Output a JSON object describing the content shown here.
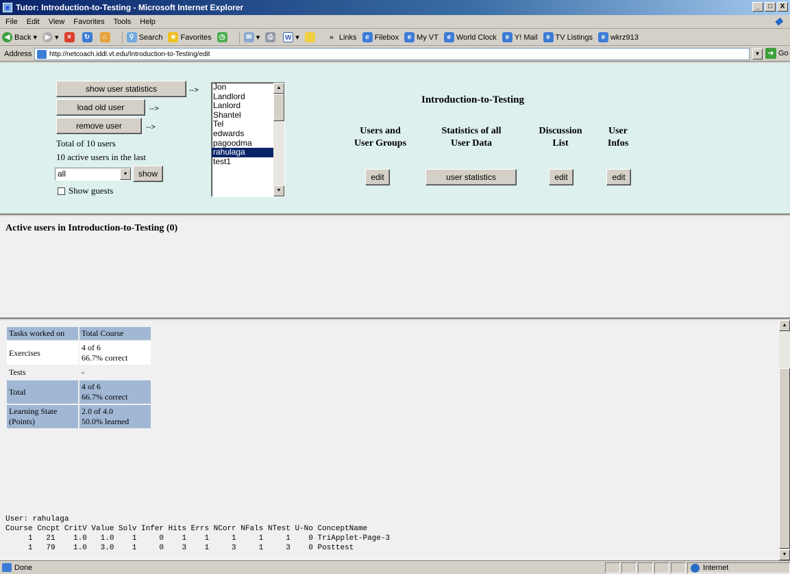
{
  "window": {
    "title": "Tutor: Introduction-to-Testing - Microsoft Internet Explorer",
    "controls": [
      "_",
      "□",
      "X"
    ]
  },
  "menu": [
    "File",
    "Edit",
    "View",
    "Favorites",
    "Tools",
    "Help"
  ],
  "toolbar": {
    "back": "Back",
    "search": "Search",
    "favorites": "Favorites",
    "links_label": "Links",
    "links": [
      "Filebox",
      "My VT",
      "World Clock",
      "Y! Mail",
      "TV Listings",
      "wkrz913"
    ]
  },
  "address": {
    "label": "Address",
    "url": "http://netcoach.iddl.vt.edu/Introduction-to-Testing/edit",
    "go": "Go"
  },
  "top_frame": {
    "show_stats_btn": "show user statistics",
    "load_old_btn": "load old user",
    "remove_btn": "remove user",
    "arrow": "-->",
    "total_users": "Total of 10 users",
    "active_users": "10 active users in the last",
    "period_value": "all",
    "show_btn": "show",
    "show_guests": "Show guests",
    "user_list": [
      "Jon",
      "Landlord",
      "Lanlord",
      "Shantel",
      "Tel",
      "edwards",
      "pagoodma",
      "rahulaga",
      "test1"
    ],
    "selected_user": "rahulaga",
    "course_title": "Introduction-to-Testing",
    "sections": [
      {
        "title": "Users and\nUser Groups",
        "button": "edit"
      },
      {
        "title": "Statistics of all\nUser Data",
        "button": "user statistics"
      },
      {
        "title": "Discussion\nList",
        "button": "edit"
      },
      {
        "title": "User\nInfos",
        "button": "edit"
      }
    ]
  },
  "mid_frame": {
    "active_heading": "Active users in Introduction-to-Testing (0)"
  },
  "stats_table": {
    "headers": [
      "Tasks worked on",
      "Total Course"
    ],
    "rows": [
      {
        "label": "Exercises",
        "value": "4 of 6\n66.7% correct"
      },
      {
        "label": "Tests",
        "value": "-"
      },
      {
        "label": "Total",
        "value": "4 of 6\n66.7% correct"
      },
      {
        "label": "Learning State (Points)",
        "value": "2.0 of 4.0\n50.0% learned"
      }
    ]
  },
  "user_report": {
    "user_line": "User: rahulaga",
    "header_line": "Course Cncpt CritV Value Solv Infer Hits Errs NCorr NFals NTest U-No ConceptName",
    "rows": [
      "     1   21    1.0   1.0    1     0    1    1     1     1     1    0 TriApplet-Page-3",
      "     1   79    1.0   3.0    1     0    3    1     3     1     3    0 Posttest"
    ]
  },
  "status": {
    "text": "Done",
    "zone": "Internet"
  }
}
